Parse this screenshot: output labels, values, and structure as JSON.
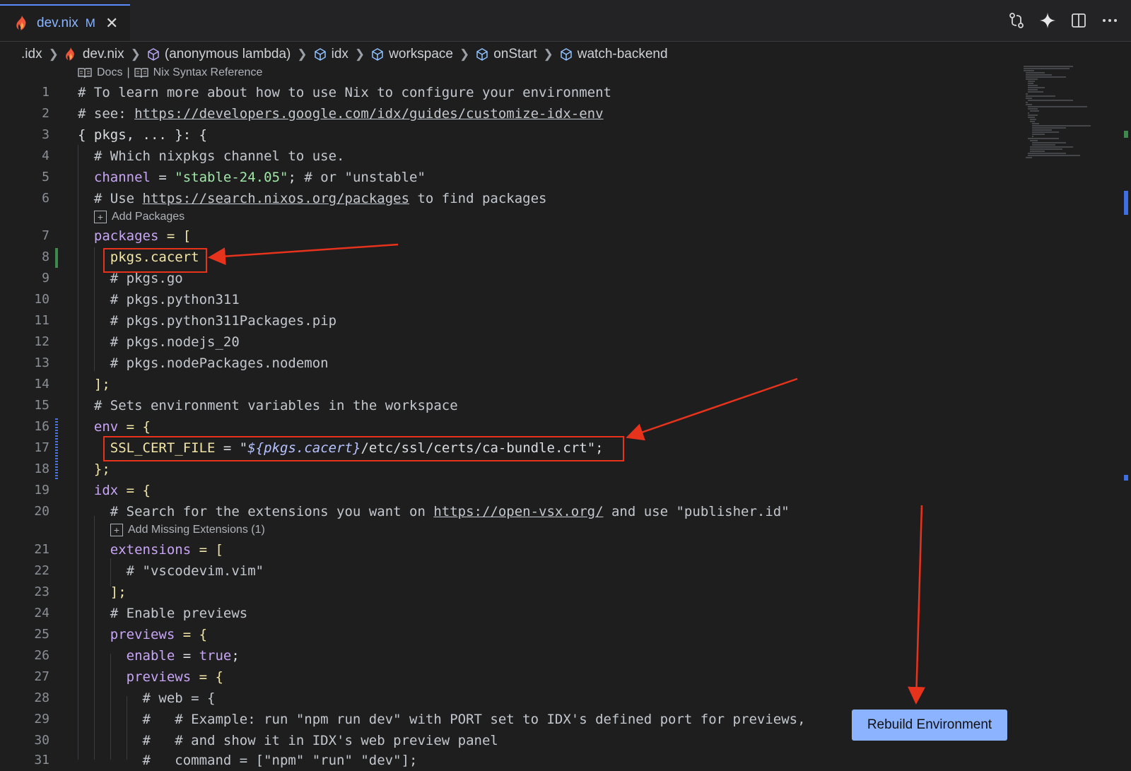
{
  "tab": {
    "filename": "dev.nix",
    "modified": "M",
    "close": "✕"
  },
  "breadcrumb": [
    {
      "label": ".idx",
      "icon": "none"
    },
    {
      "label": "dev.nix",
      "icon": "nix-flame-icon"
    },
    {
      "label": "(anonymous lambda)",
      "icon": "cube-icon"
    },
    {
      "label": "idx",
      "icon": "cube-icon"
    },
    {
      "label": "workspace",
      "icon": "cube-icon"
    },
    {
      "label": "onStart",
      "icon": "cube-icon"
    },
    {
      "label": "watch-backend",
      "icon": "cube-icon"
    }
  ],
  "codelens": {
    "docs": "Docs",
    "divider": "|",
    "syntax_ref": "Nix Syntax Reference",
    "add_packages": "Add Packages",
    "add_extensions": "Add Missing Extensions (1)"
  },
  "lines": {
    "n1": "1",
    "n2": "2",
    "n3": "3",
    "n4": "4",
    "n5": "5",
    "n6": "6",
    "n7": "7",
    "n8": "8",
    "n9": "9",
    "n10": "10",
    "n11": "11",
    "n12": "12",
    "n13": "13",
    "n14": "14",
    "n15": "15",
    "n16": "16",
    "n17": "17",
    "n18": "18",
    "n19": "19",
    "n20": "20",
    "n21": "21",
    "n22": "22",
    "n23": "23",
    "n24": "24",
    "n25": "25",
    "n26": "26",
    "n27": "27",
    "n28": "28",
    "n29": "29",
    "n30": "30",
    "n31": "31",
    "l1": "# To learn more about how to use Nix to configure your environment",
    "l2a": "# see: ",
    "l2b": "https://developers.google.com/idx/guides/customize-idx-env",
    "l3a": "{ ",
    "l3b": "pkgs",
    "l3c": ", ... }: {",
    "l4": "# Which nixpkgs channel to use.",
    "l5a": "channel",
    "l5b": " = ",
    "l5c": "\"stable-24.05\"",
    "l5d": "; ",
    "l5e": "# or \"unstable\"",
    "l6a": "# Use ",
    "l6b": "https://search.nixos.org/packages",
    "l6c": " to find packages",
    "l7a": "packages",
    "l7b": " = [",
    "l8": "pkgs.cacert",
    "l9": "# pkgs.go",
    "l10": "# pkgs.python311",
    "l11": "# pkgs.python311Packages.pip",
    "l12": "# pkgs.nodejs_20",
    "l13": "# pkgs.nodePackages.nodemon",
    "l14": "];",
    "l15": "# Sets environment variables in the workspace",
    "l16a": "env",
    "l16b": " = {",
    "l17a": "SSL_CERT_FILE",
    "l17b": " = \"",
    "l17c": "${",
    "l17d": "pkgs.cacert",
    "l17e": "}",
    "l17f": "/etc/ssl/certs/ca-bundle.crt",
    "l17g": "\";",
    "l18": "};",
    "l19a": "idx",
    "l19b": " = {",
    "l20a": "# Search for the extensions you want on ",
    "l20b": "https://open-vsx.org/",
    "l20c": " and use \"publisher.id\"",
    "l21a": "extensions",
    "l21b": " = [",
    "l22": "# \"vscodevim.vim\"",
    "l23": "];",
    "l24": "# Enable previews",
    "l25a": "previews",
    "l25b": " = {",
    "l26a": "enable",
    "l26b": " = ",
    "l26c": "true",
    "l26d": ";",
    "l27a": "previews",
    "l27b": " = {",
    "l28": "# web = {",
    "l29": "#   # Example: run \"npm run dev\" with PORT set to IDX's defined port for previews,",
    "l30": "#   # and show it in IDX's web preview panel",
    "l31": "#   command = [\"npm\" \"run\" \"dev\"];"
  },
  "rebuild_button": "Rebuild Environment",
  "icons": [
    "source-control-icon",
    "sparkle-icon",
    "split-editor-icon",
    "more-actions-icon"
  ],
  "colors": {
    "accent": "#8ab4ff",
    "annotation": "#e8331c",
    "button": "#8cb3ff"
  }
}
